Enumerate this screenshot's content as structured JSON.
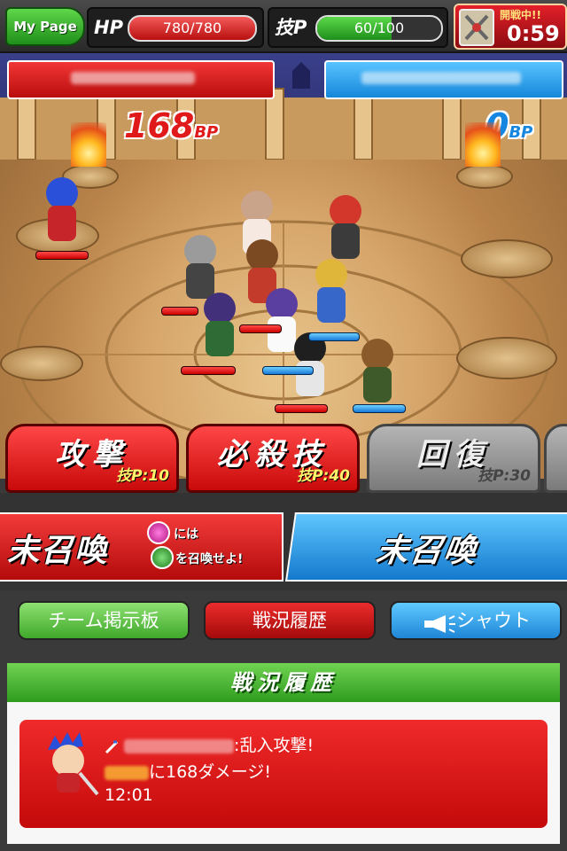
{
  "topbar": {
    "mypage_label": "My Page",
    "hp_label": "HP",
    "hp_value": "780/780",
    "sp_label": "技P",
    "sp_value": "60/100",
    "sp_fraction": 0.6,
    "timer_status": "開戦中!!",
    "timer_value": "0:59"
  },
  "arena": {
    "bp_left": "168",
    "bp_right": "0",
    "bp_unit": "BP"
  },
  "skills": [
    {
      "name": "攻撃",
      "cost": "技P:10",
      "enabled": true
    },
    {
      "name": "必殺技",
      "cost": "技P:40",
      "enabled": true
    },
    {
      "name": "回復",
      "cost": "技P:30",
      "enabled": false
    }
  ],
  "summon": {
    "left_title": "未召喚",
    "note_a": "には",
    "note_b": "を召喚せよ!",
    "right_title": "未召喚"
  },
  "tabs": {
    "board": "チーム掲示板",
    "history": "戦況履歴",
    "shout": "シャウト"
  },
  "history": {
    "header": "戦況履歴",
    "line1_suffix": ":乱入攻撃!",
    "line2_suffix": "に168ダメージ!",
    "time": "12:01"
  },
  "colors": {
    "red": "#e0191f",
    "blue": "#1f8ad8",
    "green": "#3fa92b"
  }
}
